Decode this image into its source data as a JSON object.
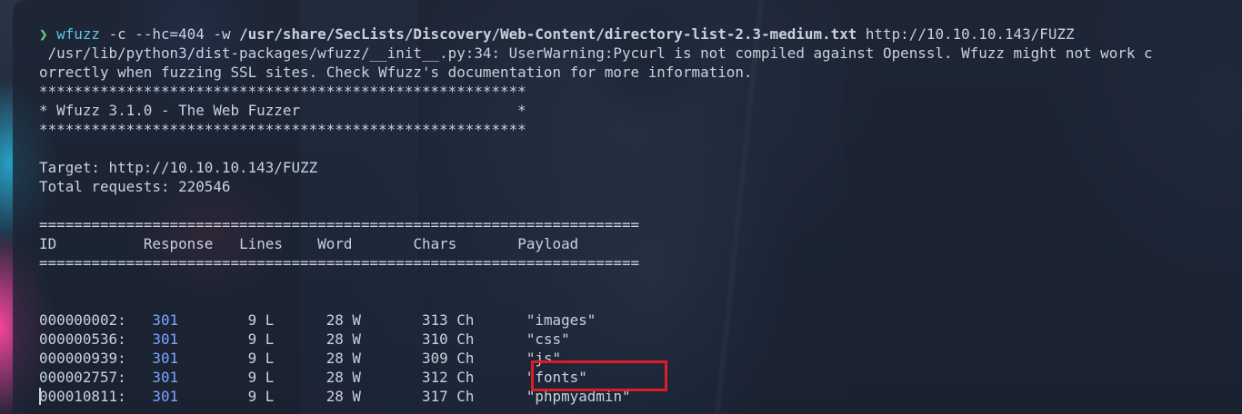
{
  "command": {
    "prompt": "❯",
    "program": "wfuzz",
    "args_pre": " -c --hc=404 -w ",
    "wordlist": "/usr/share/SecLists/Discovery/Web-Content/directory-list-2.3-medium.txt",
    "url": " http://10.10.10.143/FUZZ"
  },
  "warning": {
    "line1": " /usr/lib/python3/dist-packages/wfuzz/__init__.py:34: UserWarning:Pycurl is not compiled against Openssl. Wfuzz might not work c",
    "line2": "orrectly when fuzzing SSL sites. Check Wfuzz's documentation for more information."
  },
  "banner": {
    "border": "********************************************************",
    "title": "* Wfuzz 3.1.0 - The Web Fuzzer                         *"
  },
  "target": "Target: http://10.10.10.143/FUZZ",
  "total_requests": "Total requests: 220546",
  "separator": "=====================================================================",
  "headers": {
    "id": "ID",
    "response": "Response",
    "lines": "Lines",
    "word": "Word",
    "chars": "Chars",
    "payload": "Payload"
  },
  "results": [
    {
      "id": "000000002:",
      "response": "301",
      "lines": "9 L",
      "word": "28 W",
      "chars": "313 Ch",
      "payload": "\"images\""
    },
    {
      "id": "000000536:",
      "response": "301",
      "lines": "9 L",
      "word": "28 W",
      "chars": "310 Ch",
      "payload": "\"css\""
    },
    {
      "id": "000000939:",
      "response": "301",
      "lines": "9 L",
      "word": "28 W",
      "chars": "309 Ch",
      "payload": "\"js\""
    },
    {
      "id": "000002757:",
      "response": "301",
      "lines": "9 L",
      "word": "28 W",
      "chars": "312 Ch",
      "payload": "\"fonts\""
    },
    {
      "id": "000010811:",
      "response": "301",
      "lines": "9 L",
      "word": "28 W",
      "chars": "317 Ch",
      "payload": "\"phpmyadmin\""
    }
  ],
  "colors": {
    "prompt": "#5fd97f",
    "command": "#5fc4e8",
    "status_code": "#7aa6ff",
    "highlight": "#e01b24"
  }
}
